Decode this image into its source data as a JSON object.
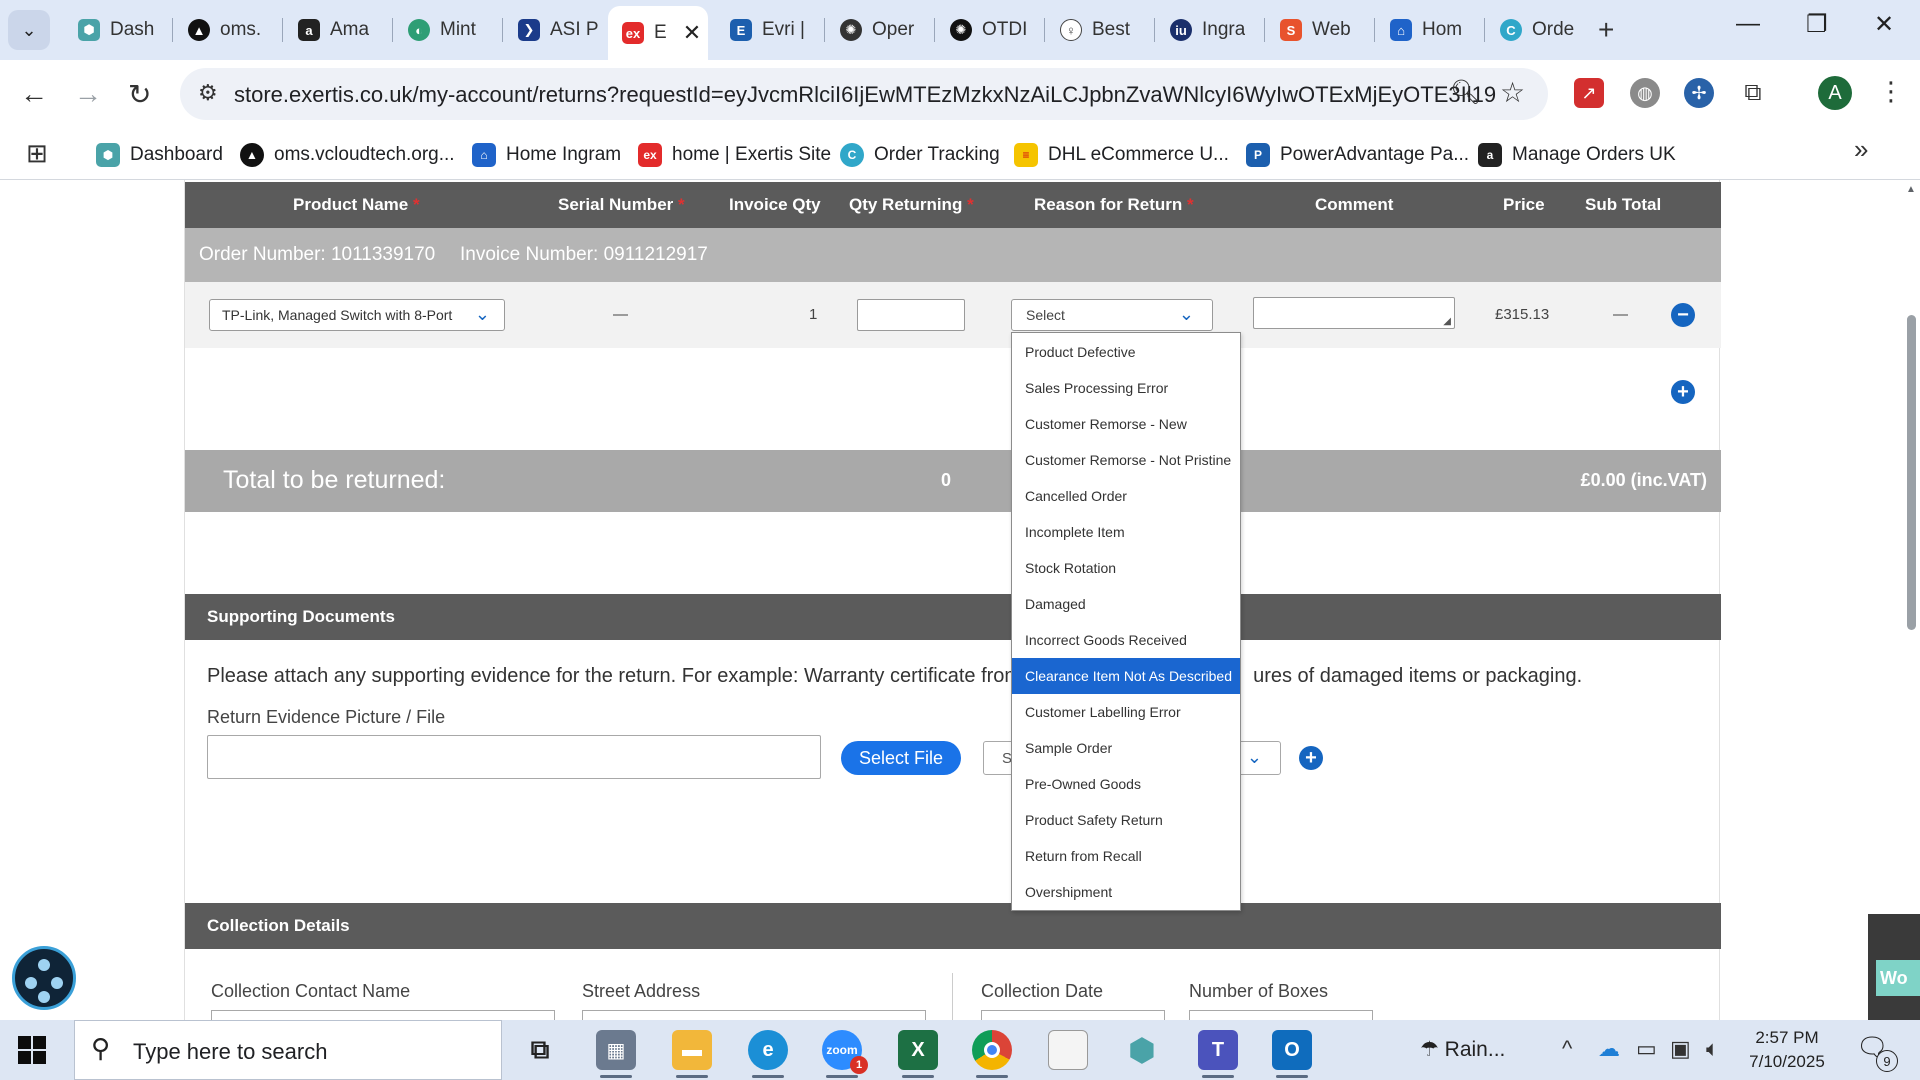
{
  "browser": {
    "tabs": [
      {
        "title": "Dash",
        "icon": "hexagon-teal-icon",
        "color": "#4aa3a8"
      },
      {
        "title": "oms.",
        "icon": "triangle-logo-icon",
        "color": "#111111"
      },
      {
        "title": "Ama",
        "icon": "amazon-icon",
        "color": "#222222"
      },
      {
        "title": "Mint",
        "icon": "leaf-icon",
        "color": "#2e9e75"
      },
      {
        "title": "ASI P",
        "icon": "arrow-logo-icon",
        "color": "#1b3b8a"
      },
      {
        "title": "E",
        "icon": "exertis-icon",
        "color": "#e32b2b",
        "active": true
      },
      {
        "title": "Evri |",
        "icon": "e-logo-icon",
        "color": "#1c5fae"
      },
      {
        "title": "Oper",
        "icon": "openai-icon",
        "color": "#333333"
      },
      {
        "title": "OTDI",
        "icon": "openai-dark-icon",
        "color": "#111111"
      },
      {
        "title": "Best",
        "icon": "bulb-icon",
        "color": "#444444"
      },
      {
        "title": "Ingra",
        "icon": "ingram-icon",
        "color": "#1a2f6b"
      },
      {
        "title": "Web",
        "icon": "web-logo-icon",
        "color": "#e8532d"
      },
      {
        "title": "Hom",
        "icon": "home-logo-icon",
        "color": "#1f63c9"
      },
      {
        "title": "Orde",
        "icon": "order-logo-icon",
        "color": "#30a7c9"
      }
    ],
    "url": "store.exertis.co.uk/my-account/returns?requestId=eyJvcmRlciI6IjEwMTEzMzkxNzAiLCJpbnZvaWNlcyI6WyIwOTExMjEyOTE3Il19",
    "avatar_letter": "A",
    "bookmarks": [
      {
        "label": "Dashboard",
        "color": "#4aa3a8"
      },
      {
        "label": "oms.vcloudtech.org...",
        "color": "#111111"
      },
      {
        "label": "Home Ingram",
        "color": "#1f63c9"
      },
      {
        "label": "home | Exertis Site",
        "color": "#e32b2b"
      },
      {
        "label": "Order Tracking",
        "color": "#30a7c9"
      },
      {
        "label": "DHL eCommerce U...",
        "color": "#f5c400"
      },
      {
        "label": "PowerAdvantage Pa...",
        "color": "#1c5fae"
      },
      {
        "label": "Manage Orders UK",
        "color": "#222222"
      }
    ]
  },
  "returns": {
    "headers": {
      "product_name": "Product Name",
      "serial_number": "Serial Number",
      "invoice_qty": "Invoice Qty",
      "qty_returning": "Qty Returning",
      "reason": "Reason for Return",
      "comment": "Comment",
      "price": "Price",
      "sub_total": "Sub Total",
      "required_mark": "*"
    },
    "order_number": "Order Number: 1011339170",
    "invoice_number": "Invoice Number: 0911212917",
    "item": {
      "product": "TP-Link, Managed Switch with 8-Port",
      "serial": "—",
      "invoice_qty": "1",
      "qty_returning": "",
      "reason_placeholder": "Select",
      "comment": "",
      "price": "£315.13",
      "sub_total": "—"
    },
    "total_label": "Total to be returned:",
    "total_qty": "0",
    "total_amount": "£0.00 (inc.VAT)",
    "reason_options": [
      "Product Defective",
      "Sales Processing Error",
      "Customer Remorse - New",
      "Customer Remorse - Not Pristine",
      "Cancelled Order",
      "Incomplete Item",
      "Stock Rotation",
      "Damaged",
      "Incorrect Goods Received",
      "Clearance Item Not As Described",
      "Customer Labelling Error",
      "Sample Order",
      "Pre-Owned Goods",
      "Product Safety Return",
      "Return from Recall",
      "Overshipment"
    ],
    "highlighted_option_index": 9,
    "accent_color": "#1a66d0"
  },
  "supporting": {
    "title": "Supporting Documents",
    "text_before": "Please attach any supporting evidence for the return. For example: Warranty certificate from",
    "text_after": "ures of damaged items or packaging.",
    "file_label": "Return Evidence Picture / File",
    "select_file": "Select File",
    "doc_type_value": "S"
  },
  "collection": {
    "title": "Collection Details",
    "contact_label": "Collection Contact Name",
    "street_label": "Street Address",
    "date_label": "Collection Date",
    "boxes_label": "Number of Boxes"
  },
  "side_widget_text": "Wo",
  "taskbar": {
    "search_placeholder": "Type here to search",
    "weather": "Rain...",
    "time": "2:57 PM",
    "date": "7/10/2025",
    "notification_count": "9",
    "zoom_badge": "1",
    "apps": [
      "task-view-icon",
      "calculator-icon",
      "file-explorer-icon",
      "edge-icon",
      "zoom-icon",
      "excel-icon",
      "chrome-icon",
      "notepad-icon",
      "app-hexagon-icon",
      "teams-icon",
      "outlook-icon"
    ]
  }
}
